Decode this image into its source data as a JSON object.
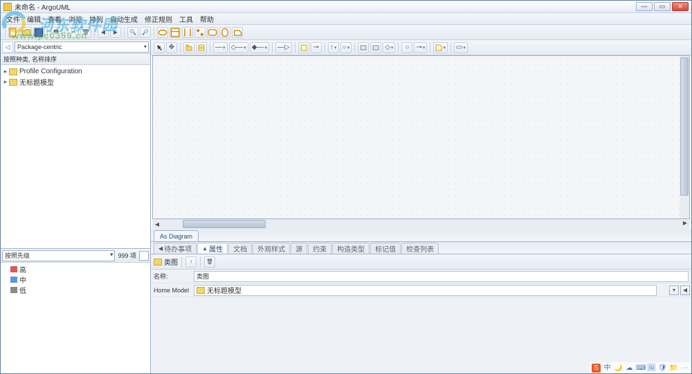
{
  "title": "未命名 - ArgoUML",
  "menu": [
    "文件",
    "编辑",
    "查看",
    "浏览",
    "排列",
    "自动生成",
    "修正规则",
    "工具",
    "帮助"
  ],
  "explorer": {
    "back": "◁",
    "perspective": "Package-centric",
    "sort_label": "按照种类, 名称排序",
    "nodes": [
      {
        "exp": "▸",
        "label": "Profile Configuration"
      },
      {
        "exp": "▸",
        "label": "无标题模型"
      }
    ]
  },
  "todo": {
    "combo": "按照先级",
    "count": "999 项",
    "priorities": [
      {
        "cls": "h",
        "label": "高"
      },
      {
        "cls": "m",
        "label": "中"
      },
      {
        "cls": "l",
        "label": "低"
      }
    ]
  },
  "diagram_tab": "As Diagram",
  "detail_tabs": [
    {
      "label": "待办事项",
      "arrow": "◀",
      "active": false
    },
    {
      "label": "属性",
      "arrow": "▲",
      "active": true
    },
    {
      "label": "文档",
      "arrow": "",
      "active": false
    },
    {
      "label": "外观样式",
      "arrow": "",
      "active": false
    },
    {
      "label": "源",
      "arrow": "",
      "active": false
    },
    {
      "label": "约束",
      "arrow": "",
      "active": false
    },
    {
      "label": "构造类型",
      "arrow": "",
      "active": false
    },
    {
      "label": "标记值",
      "arrow": "",
      "active": false
    },
    {
      "label": "检查列表",
      "arrow": "",
      "active": false
    }
  ],
  "detail_type": "类图",
  "form": {
    "name_label": "名称:",
    "name_value": "类图",
    "home_label": "Home Model",
    "home_value": "无标题模型"
  },
  "watermark": {
    "text": "河东软件园",
    "url": "www.pc0359.cn"
  },
  "tray": [
    "S",
    "中",
    "🌙",
    "☁",
    "⌨",
    "🖼",
    "🛡",
    "📁",
    "⋯"
  ]
}
